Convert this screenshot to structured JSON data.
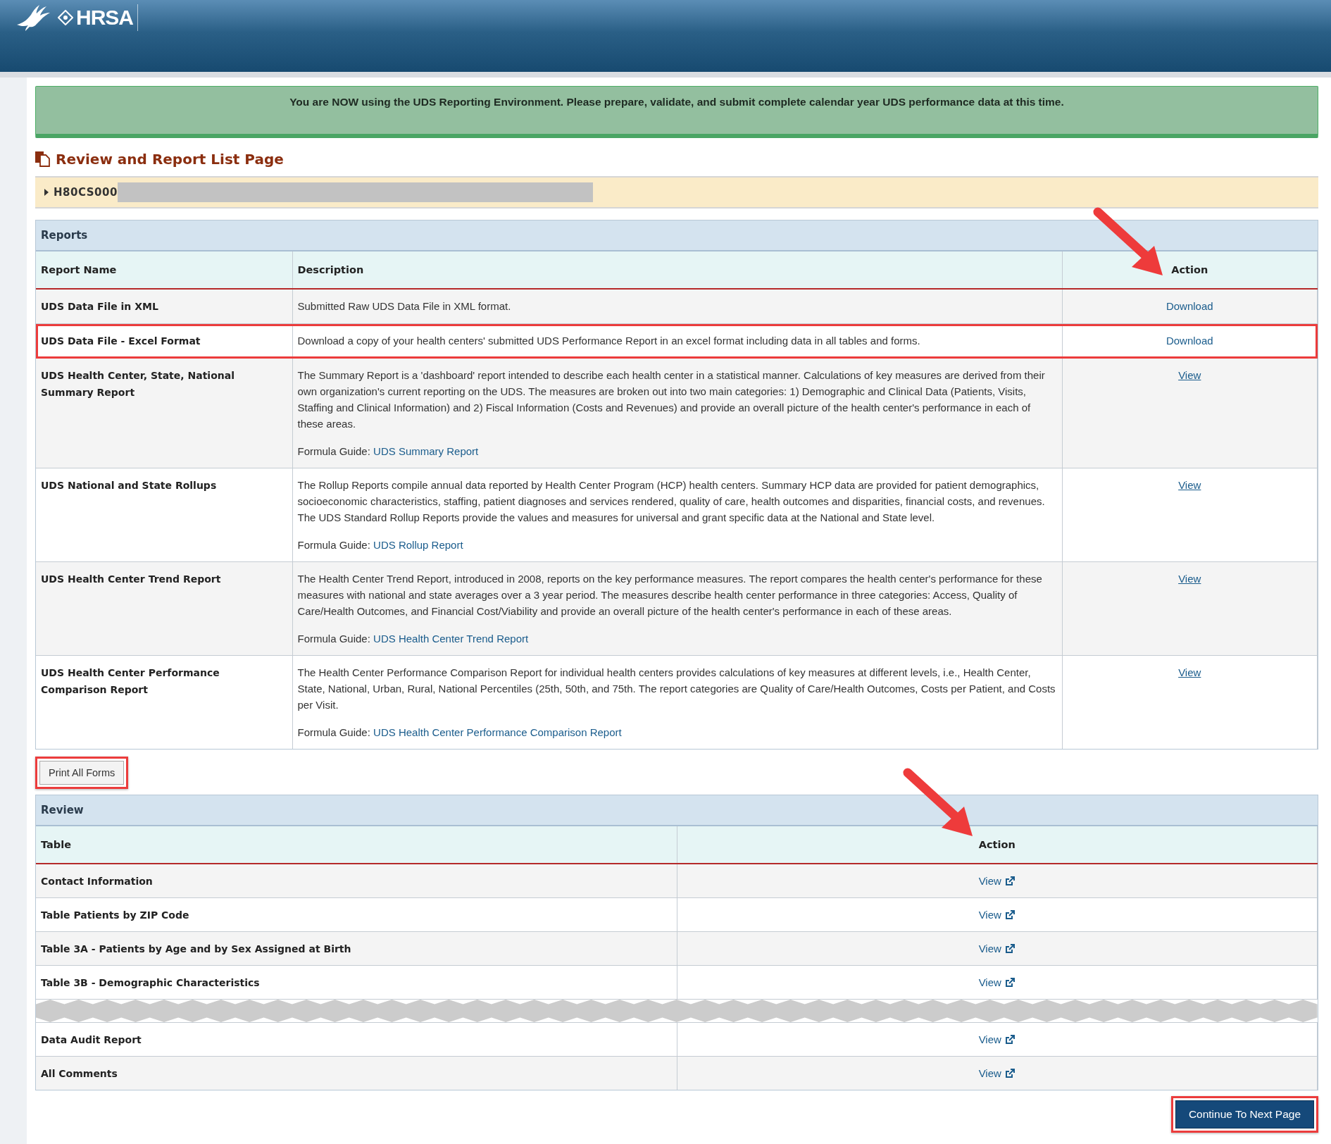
{
  "header": {
    "logo": "HRSA"
  },
  "banner": {
    "message": "You are NOW using the UDS Reporting Environment. Please prepare, validate, and submit complete calendar year UDS performance data at this time."
  },
  "page_title": "Review and Report List Page",
  "grantee": {
    "id": "H80CS000",
    "expanded": false
  },
  "reports": {
    "title": "Reports",
    "columns": [
      "Report Name",
      "Description",
      "Action"
    ],
    "rows": [
      {
        "name": "UDS Data File in XML",
        "description": [
          "Submitted Raw UDS Data File in XML format."
        ],
        "action": "Download",
        "underlined": false,
        "highlighted": false
      },
      {
        "name": "UDS Data File - Excel Format",
        "description": [
          "Download a copy of your health centers' submitted UDS Performance Report in an excel format including data in all tables and forms."
        ],
        "action": "Download",
        "underlined": false,
        "highlighted": true
      },
      {
        "name": "UDS Health Center, State, National Summary Report",
        "description": [
          "The Summary Report is a 'dashboard' report intended to describe each health center in a statistical manner. Calculations of key measures are derived from their own organization's current reporting on the UDS. The measures are broken out into two main categories: 1) Demographic and Clinical Data (Patients, Visits, Staffing and Clinical Information) and 2) Fiscal Information (Costs and Revenues) and provide an overall picture of the health center's performance in each of these areas."
        ],
        "formula_label": "Formula Guide:",
        "formula_link": "UDS Summary Report",
        "action": "View",
        "underlined": true,
        "highlighted": false
      },
      {
        "name": "UDS National and State Rollups",
        "description": [
          "The Rollup Reports compile annual data reported by Health Center Program (HCP) health centers. Summary HCP data are provided for patient demographics, socioeconomic characteristics, staffing, patient diagnoses and services rendered, quality of care, health outcomes and disparities, financial costs, and revenues.",
          "The UDS Standard Rollup Reports provide the values and measures for universal and grant specific data at the National and State level."
        ],
        "formula_label": "Formula Guide:",
        "formula_link": "UDS Rollup Report",
        "action": "View",
        "underlined": true,
        "highlighted": false
      },
      {
        "name": "UDS Health Center Trend Report",
        "description": [
          "The Health Center Trend Report, introduced in 2008, reports on the key performance measures. The report compares the health center's performance for these measures with national and state averages over a 3 year period. The measures describe health center performance in three categories: Access, Quality of Care/Health Outcomes, and Financial Cost/Viability and provide an overall picture of the health center's performance in each of these areas."
        ],
        "formula_label": "Formula Guide:",
        "formula_link": "UDS Health Center Trend Report",
        "action": "View",
        "underlined": true,
        "highlighted": false
      },
      {
        "name": "UDS Health Center Performance Comparison Report",
        "description": [
          "The Health Center Performance Comparison Report for individual health centers provides calculations of key measures at different levels, i.e., Health Center, State, National, Urban, Rural, National Percentiles (25th, 50th, and 75th. The report categories are Quality of Care/Health Outcomes, Costs per Patient, and Costs per Visit."
        ],
        "formula_label": "Formula Guide:",
        "formula_link": "UDS Health Center Performance Comparison Report",
        "action": "View",
        "underlined": true,
        "highlighted": false
      }
    ]
  },
  "print_button": {
    "label": "Print All Forms",
    "highlighted": true
  },
  "review": {
    "title": "Review",
    "columns": [
      "Table",
      "Action"
    ],
    "rows": [
      {
        "kind": "table",
        "name": "Contact Information",
        "action": "View"
      },
      {
        "kind": "table",
        "name": "Table Patients by ZIP Code",
        "action": "View"
      },
      {
        "kind": "table",
        "name": "Table 3A - Patients by Age and by Sex Assigned at Birth",
        "action": "View"
      },
      {
        "kind": "table",
        "name": "Table 3B - Demographic Characteristics",
        "action": "View"
      },
      {
        "kind": "tear"
      },
      {
        "kind": "table",
        "name": "Data Audit Report",
        "action": "View"
      },
      {
        "kind": "table",
        "name": "All Comments",
        "action": "View"
      }
    ]
  },
  "continue_button": {
    "label": "Continue To Next Page",
    "highlighted": true
  }
}
